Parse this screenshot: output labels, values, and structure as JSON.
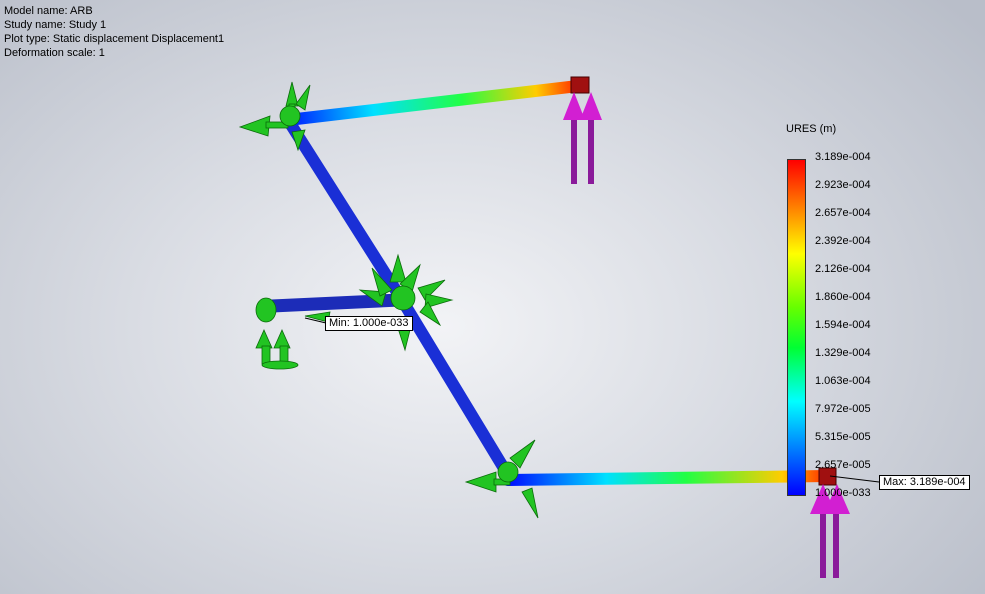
{
  "info": {
    "model_name": "Model name: ARB",
    "study_name": "Study name: Study 1",
    "plot_type": "Plot type: Static displacement Displacement1",
    "deformation_scale": "Deformation scale: 1"
  },
  "legend": {
    "title": "URES (m)",
    "ticks": [
      "3.189e-004",
      "2.923e-004",
      "2.657e-004",
      "2.392e-004",
      "2.126e-004",
      "1.860e-004",
      "1.594e-004",
      "1.329e-004",
      "1.063e-004",
      "7.972e-005",
      "5.315e-005",
      "2.657e-005",
      "1.000e-033"
    ],
    "colors": {
      "max": "#ff0000",
      "mid": "#00ff33",
      "min": "#0000ff"
    }
  },
  "probes": {
    "min_label": "Min: 1.000e-033",
    "max_label": "Max: 3.189e-004"
  }
}
